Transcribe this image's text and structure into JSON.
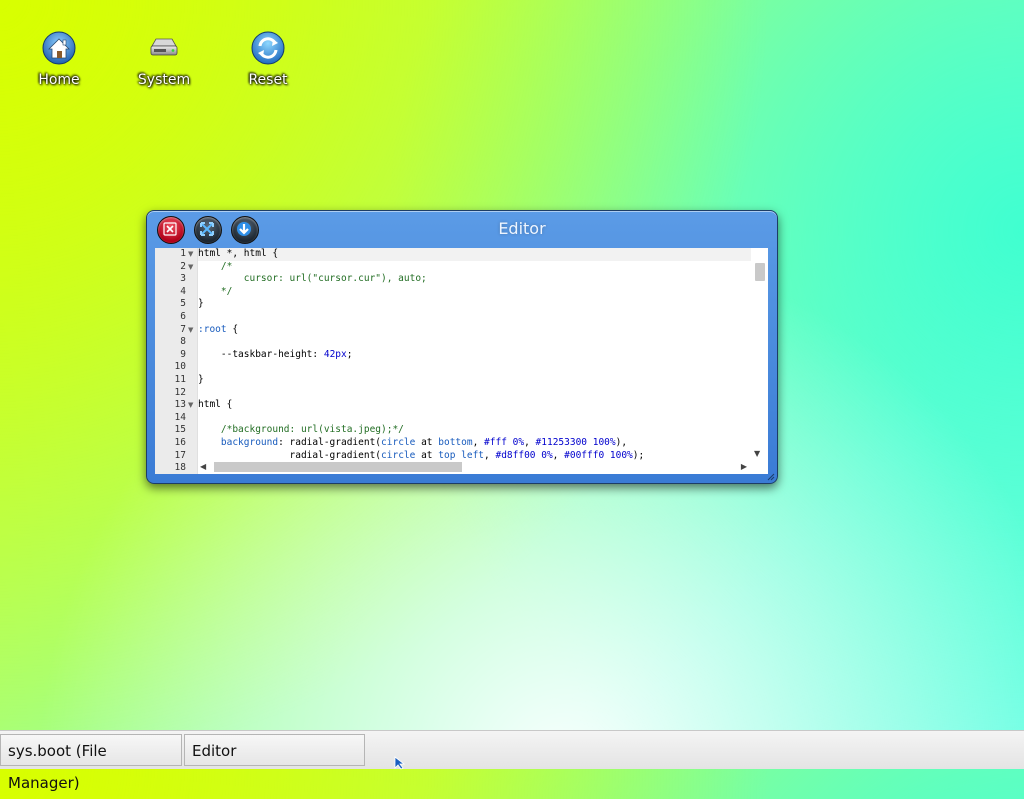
{
  "desktop": {
    "icons": [
      {
        "label": "Home",
        "icon": "home-icon"
      },
      {
        "label": "System",
        "icon": "drive-icon"
      },
      {
        "label": "Reset",
        "icon": "refresh-icon"
      }
    ]
  },
  "window": {
    "title": "Editor",
    "buttons": {
      "close": "close-icon",
      "maximize": "expand-icon",
      "minimize": "minimize-icon"
    },
    "editor": {
      "line_numbers": [
        "1",
        "2",
        "3",
        "4",
        "5",
        "6",
        "7",
        "8",
        "9",
        "10",
        "11",
        "12",
        "13",
        "14",
        "15",
        "16",
        "17",
        "18"
      ],
      "fold_markers": [
        "1",
        "2",
        "7",
        "13"
      ],
      "lines": [
        [
          {
            "t": "html *, html {",
            "c": "plain"
          }
        ],
        [
          {
            "t": "    /*",
            "c": "comment"
          }
        ],
        [
          {
            "t": "        cursor: url(\"cursor.cur\"), auto;",
            "c": "comment"
          }
        ],
        [
          {
            "t": "    */",
            "c": "comment"
          }
        ],
        [
          {
            "t": "}",
            "c": "plain"
          }
        ],
        [
          {
            "t": "",
            "c": "plain"
          }
        ],
        [
          {
            "t": ":root",
            "c": "root"
          },
          {
            "t": " {",
            "c": "plain"
          }
        ],
        [
          {
            "t": "",
            "c": "plain"
          }
        ],
        [
          {
            "t": "    --taskbar-height: ",
            "c": "plain"
          },
          {
            "t": "42px",
            "c": "num"
          },
          {
            "t": ";",
            "c": "plain"
          }
        ],
        [
          {
            "t": "",
            "c": "plain"
          }
        ],
        [
          {
            "t": "}",
            "c": "plain"
          }
        ],
        [
          {
            "t": "",
            "c": "plain"
          }
        ],
        [
          {
            "t": "html {",
            "c": "plain"
          }
        ],
        [
          {
            "t": "",
            "c": "plain"
          }
        ],
        [
          {
            "t": "    /*background: url(vista.jpeg);*/",
            "c": "comment"
          }
        ],
        [
          {
            "t": "    background",
            "c": "prop"
          },
          {
            "t": ": radial-gradient(",
            "c": "plain"
          },
          {
            "t": "circle",
            "c": "keyword"
          },
          {
            "t": " at ",
            "c": "plain"
          },
          {
            "t": "bottom",
            "c": "keyword"
          },
          {
            "t": ", ",
            "c": "plain"
          },
          {
            "t": "#fff 0%",
            "c": "num"
          },
          {
            "t": ", ",
            "c": "plain"
          },
          {
            "t": "#11253300 100%",
            "c": "num"
          },
          {
            "t": "),",
            "c": "plain"
          }
        ],
        [
          {
            "t": "                radial-gradient(",
            "c": "plain"
          },
          {
            "t": "circle",
            "c": "keyword"
          },
          {
            "t": " at ",
            "c": "plain"
          },
          {
            "t": "top left",
            "c": "keyword"
          },
          {
            "t": ", ",
            "c": "plain"
          },
          {
            "t": "#d8ff00 0%",
            "c": "num"
          },
          {
            "t": ", ",
            "c": "plain"
          },
          {
            "t": "#00fff0 100%",
            "c": "num"
          },
          {
            "t": ");",
            "c": "plain"
          }
        ],
        [
          {
            "t": "",
            "c": "plain"
          }
        ]
      ]
    }
  },
  "taskbar": {
    "items": [
      {
        "label": "sys.boot (File Manager)"
      },
      {
        "label": "Editor"
      }
    ]
  }
}
